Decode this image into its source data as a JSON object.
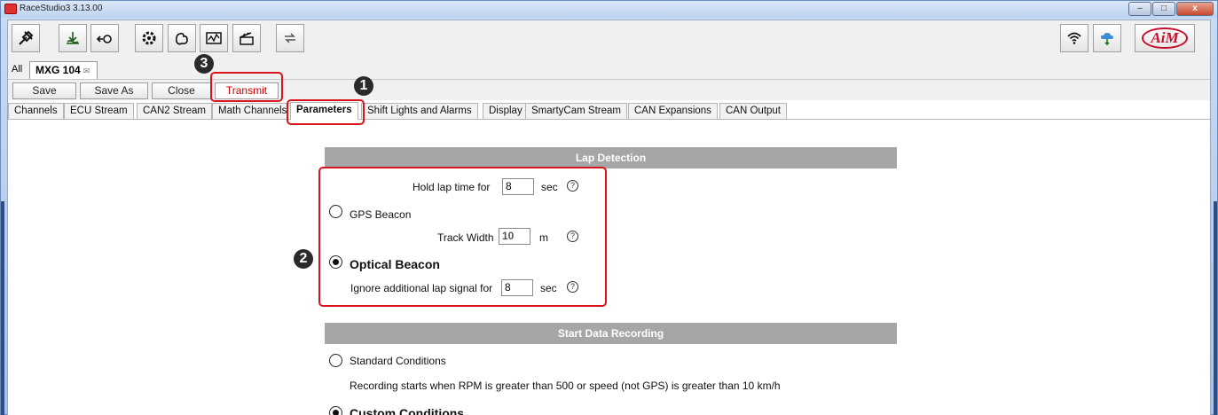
{
  "window": {
    "title": "RaceStudio3 3.13.00",
    "minimize": "–",
    "maximize": "□",
    "close": "x"
  },
  "toolbar": {
    "icons": [
      "tools-icon",
      "download-icon",
      "connect-icon",
      "config-icon",
      "tracks-icon",
      "dashboard-icon",
      "video-icon",
      "transfer-icon",
      "wifi-icon",
      "cloud-icon",
      "aim-logo"
    ],
    "logo": "AiM"
  },
  "doc_tabs": {
    "all": "All",
    "active": "MXG 104",
    "close_glyph": "✉"
  },
  "actions": {
    "save": "Save",
    "save_as": "Save As",
    "close": "Close",
    "transmit": "Transmit"
  },
  "config_tabs": [
    "Channels",
    "ECU Stream",
    "CAN2 Stream",
    "Math Channels",
    "Parameters",
    "Shift Lights and Alarms",
    "Display",
    "SmartyCam Stream",
    "CAN Expansions",
    "CAN Output"
  ],
  "badges": [
    "1",
    "2",
    "3"
  ],
  "lap_detection": {
    "header": "Lap Detection",
    "hold_label": "Hold lap time for",
    "hold_value": "8",
    "hold_unit": "sec",
    "gps_label": "GPS Beacon",
    "track_width_label": "Track Width",
    "track_width_value": "10",
    "track_width_unit": "m",
    "optical_label": "Optical Beacon",
    "ignore_label": "Ignore additional lap signal for",
    "ignore_value": "8",
    "ignore_unit": "sec",
    "help": "?"
  },
  "start_recording": {
    "header": "Start Data Recording",
    "standard_label": "Standard Conditions",
    "standard_desc": "Recording starts when RPM is greater than 500 or speed (not GPS) is greater than 10 km/h",
    "custom_label": "Custom Conditions"
  },
  "colors": {
    "highlight": "#d9141c",
    "section_header": "#a6a6a6",
    "transmit_text": "#cc0000"
  }
}
